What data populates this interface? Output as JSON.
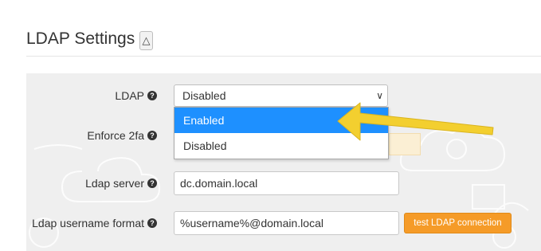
{
  "header": {
    "title": "LDAP Settings",
    "collapse_symbol": "△"
  },
  "form": {
    "ldap": {
      "label": "LDAP",
      "selected": "Disabled",
      "options": [
        "Enabled",
        "Disabled"
      ],
      "highlighted_option": "Enabled"
    },
    "enforce_2fa": {
      "label": "Enforce 2fa"
    },
    "ldap_server": {
      "label": "Ldap server",
      "value": "dc.domain.local"
    },
    "username_format": {
      "label": "Ldap username format",
      "value": "%username%@domain.local"
    },
    "test_button_label": "test LDAP connection"
  },
  "colors": {
    "accent_button": "#f59b28",
    "highlight_option": "#1e90ff",
    "annotation_arrow": "#f3cf2f"
  },
  "icons": {
    "help": "question-circle-icon",
    "collapse": "triangle-up-icon",
    "select": "chevron-down-icon",
    "annotation": "yellow-arrow-icon"
  }
}
